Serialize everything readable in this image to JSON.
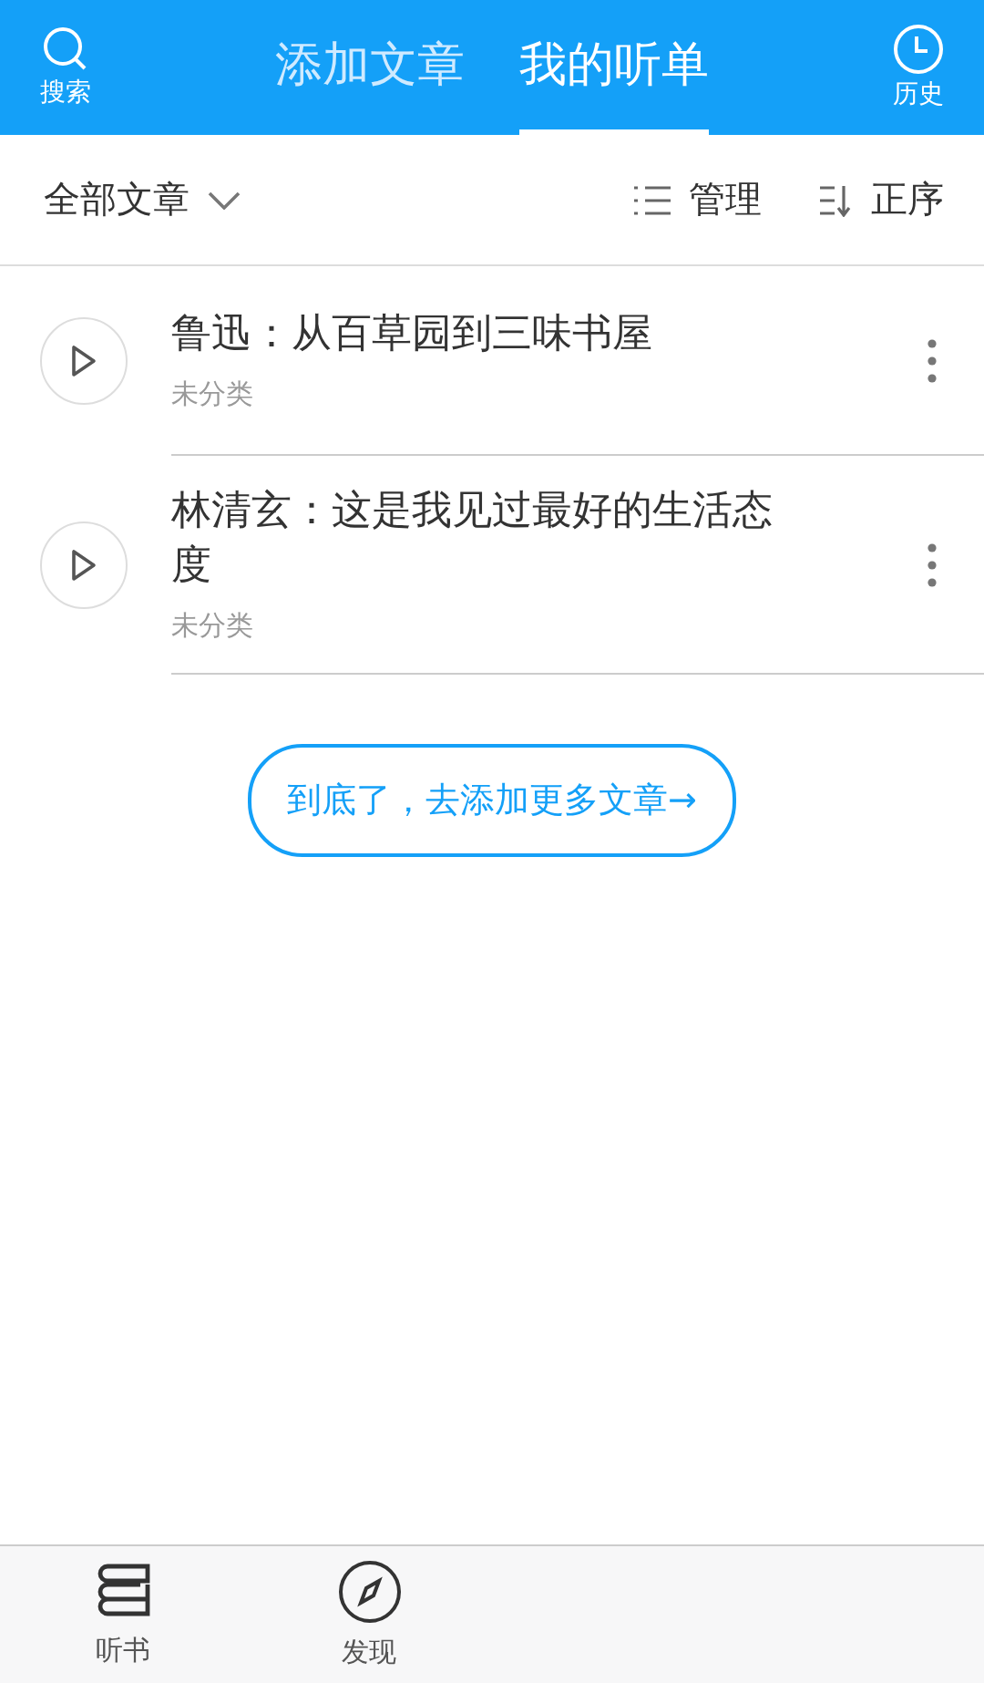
{
  "header": {
    "search_label": "搜索",
    "history_label": "历史",
    "tabs": [
      {
        "label": "添加文章",
        "selected": false
      },
      {
        "label": "我的听单",
        "selected": true
      }
    ]
  },
  "toolbar": {
    "filter": "全部文章",
    "manage": "管理",
    "sort": "正序"
  },
  "articles": [
    {
      "title": "鲁迅：从百草园到三味书屋",
      "category": "未分类"
    },
    {
      "title": "林清玄：这是我见过最好的生活态度",
      "category": "未分类"
    }
  ],
  "more_button": "到底了，去添加更多文章→",
  "bottom_nav": [
    {
      "label": "听书",
      "kind": "book"
    },
    {
      "label": "发现",
      "kind": "compass"
    }
  ]
}
